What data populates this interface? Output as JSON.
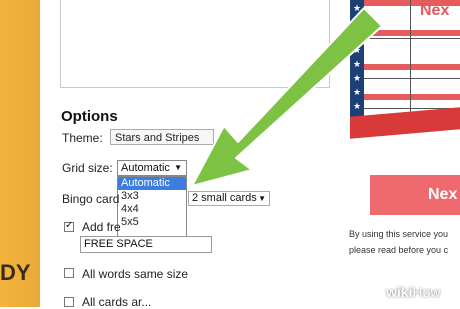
{
  "options": {
    "title": "Options",
    "theme_label": "Theme:",
    "theme_value": "Stars and Stripes",
    "grid_label": "Grid size:",
    "grid_value": "Automatic",
    "grid_options": [
      "Automatic",
      "3x3",
      "4x4",
      "5x5"
    ],
    "bingo_label": "Bingo card",
    "cards_value": "2 small cards",
    "add_free_label": "Add fre",
    "free_space_value": "FREE SPACE",
    "same_size_label": "All words same size",
    "partial_label": "All cards ar..."
  },
  "right": {
    "flag_next_partial": "Nex",
    "next_button": "Nex",
    "notice_line1": "By using this service you",
    "notice_line2": "please read before you c"
  },
  "left_strip_text": "DY",
  "watermark": {
    "bold": "wiki",
    "light": "How"
  },
  "colors": {
    "arrow": "#7dc242",
    "accent_red": "#ee6a6e",
    "highlight_blue": "#3c7de0",
    "flag_blue": "#1f3f77",
    "left_strip": "#f4b43c"
  }
}
